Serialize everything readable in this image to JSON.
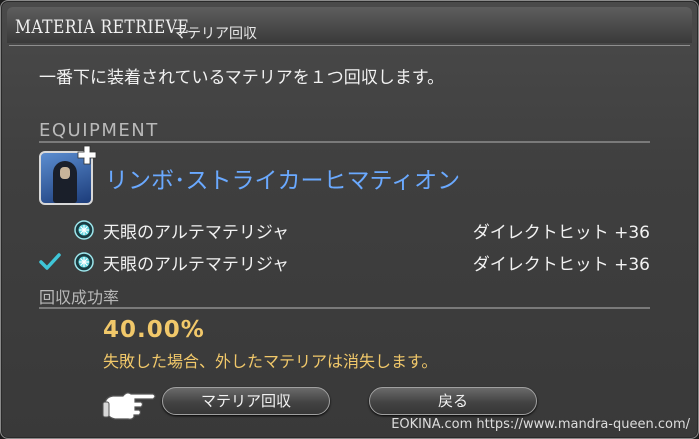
{
  "window": {
    "title_en": "MATERIA RETRIEVE",
    "title_jp": "マテリア回収"
  },
  "description": "一番下に装着されているマテリアを１つ回収します。",
  "equipment": {
    "section_label": "EQUIPMENT",
    "item_name": "リンボ･ストライカーヒマティオン",
    "icon": "hooded-figure-icon"
  },
  "materia": [
    {
      "name": "天眼のアルテマテリジャ",
      "stat": "ダイレクトヒット +36",
      "checked": false
    },
    {
      "name": "天眼のアルテマテリジャ",
      "stat": "ダイレクトヒット +36",
      "checked": true
    }
  ],
  "success_rate": {
    "label": "回収成功率",
    "value": "40.00%",
    "warning": "失敗した場合、外したマテリアは消失します。"
  },
  "buttons": {
    "retrieve": "マテリア回収",
    "back": "戻る"
  },
  "watermark": "EOKINA.com  https://www.mandra-queen.com/",
  "colors": {
    "item_name": "#6aa9ff",
    "rate": "#f1c86a",
    "check": "#3fc6d8"
  }
}
